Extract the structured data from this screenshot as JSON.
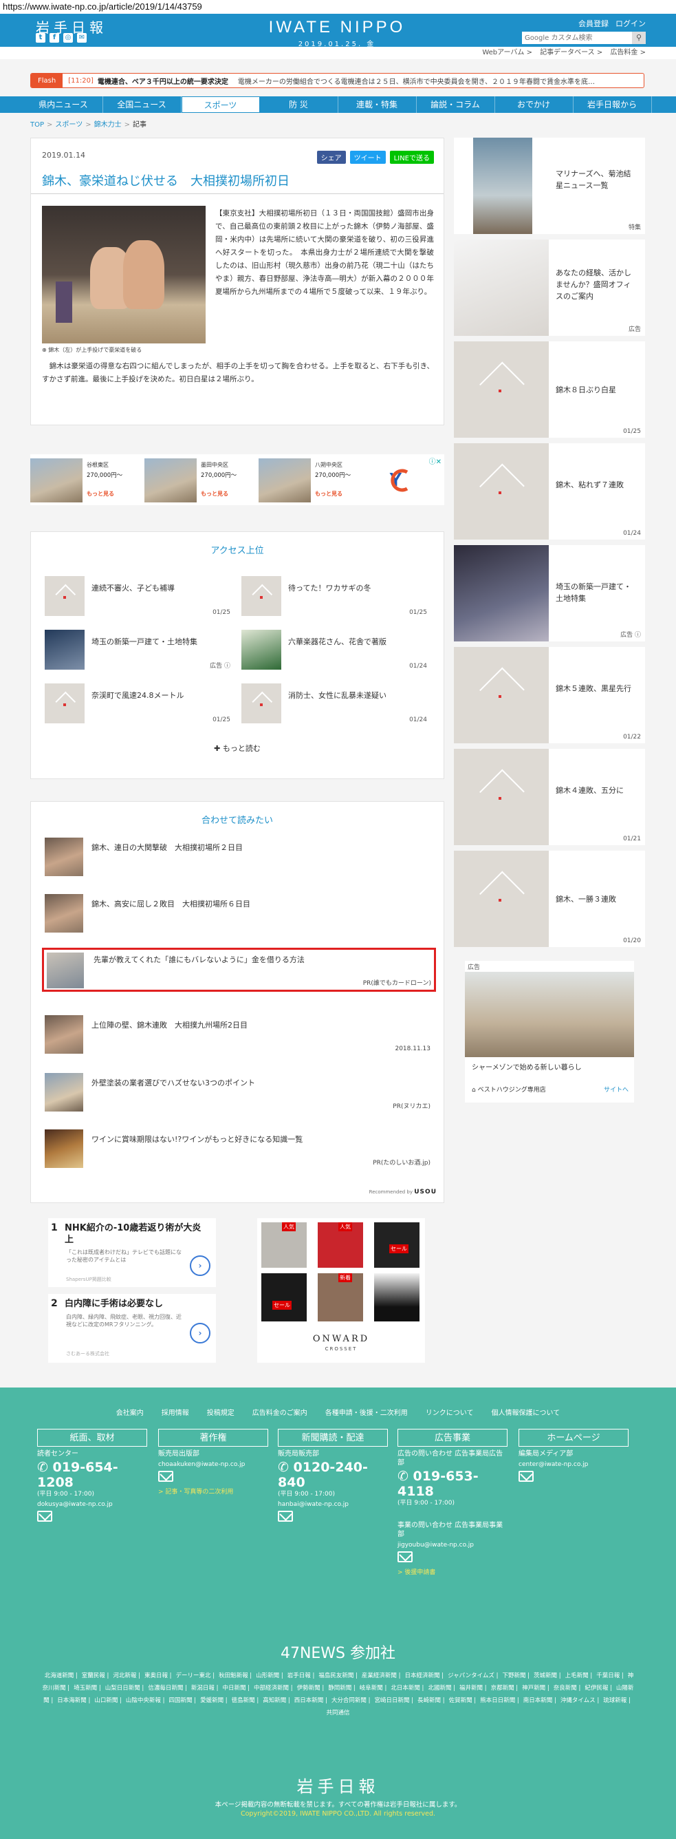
{
  "url": "https://www.iwate-np.co.jp/article/2019/1/14/43759",
  "header": {
    "logo_jp": "岩手日報",
    "brand": "IWATE NIPPO",
    "date": "2019.01.25. 金",
    "member": "会員登録",
    "login": "ログイン",
    "search_placeholder": "Google カスタム検索"
  },
  "subnav": [
    "Webアーバム >",
    "記事データベース >",
    "広告料金 >"
  ],
  "flash": {
    "tag": "Flash",
    "time": "[11:20]",
    "headline": "電機連合、ベア３千円以上の統一要求決定",
    "body": "電機メーカーの労働組合でつくる電機連合は２５日、横浜市で中央委員会を開き、２０１９年春闘で賃金水準を底…"
  },
  "nav": [
    "県内ニュース",
    "全国ニュース",
    "スポーツ",
    "防 災",
    "連載・特集",
    "論説・コラム",
    "おでかけ",
    "岩手日報から"
  ],
  "breadcrumb": [
    "TOP",
    "スポーツ",
    "錦木力士",
    "記事"
  ],
  "article": {
    "date": "2019.01.14",
    "share_fb": "シェア",
    "share_tw": "ツイート",
    "share_line": "LINEで送る",
    "title": "錦木、豪栄道ねじ伏せる　大相撲初場所初日",
    "caption": "錦木（左）が上手投げで豪栄道を破る",
    "body1": "【東京支社】大相撲初場所初日（１３日・両国国技館）盛岡市出身で、自己最高位の東前頭２枚目に上がった錦木（伊勢ノ海部屋、盛岡・米内中）は先場所に続いて大関の豪栄道を破り、初の三役昇進へ好スタートを切った。　本県出身力士が２場所連続で大関を撃破したのは、旧山形村（現久慈市）出身の前乃花（現二十山（はたちやま）親方、春日野部屋、浄法寺高―明大）が新入幕の２０００年夏場所から九州場所までの４場所で５度破って以来、１９年ぶり。",
    "body2": "　錦木は豪栄道の得意な右四つに組んでしまったが、相手の上手を切って胸を合わせる。上手を取ると、右下手も引き、すかさず前進。最後に上手投げを決めた。初日白星は２場所ぶり。"
  },
  "ad_strip": [
    {
      "place": "谷根東区",
      "price": "270,000円～",
      "more": "もっと見る"
    },
    {
      "place": "墨田中央区",
      "price": "270,000円～",
      "more": "もっと見る"
    },
    {
      "place": "八朔中央区",
      "price": "270,000円～",
      "more": "もっと見る"
    }
  ],
  "access": {
    "title": "アクセス上位",
    "more": "もっと読む",
    "items": [
      {
        "title": "連続不審火、子ども補導",
        "date": "01/25"
      },
      {
        "title": "待ってた！ワカサギの冬",
        "date": "01/25"
      },
      {
        "title": "埼玉の新築一戸建て・土地特集",
        "date": "広告 ⓘ"
      },
      {
        "title": "六華楽器花さん、花舎で著版",
        "date": "01/24"
      },
      {
        "title": "奈渓町で風速24.8メートル",
        "date": "01/25"
      },
      {
        "title": "消防士、女性に乱暴未遂疑い",
        "date": "01/24"
      }
    ]
  },
  "related": {
    "title": "合わせて読みたい",
    "items": [
      {
        "title": "錦木、連日の大関撃破　大相撲初場所２日目",
        "src": ""
      },
      {
        "title": "錦木、高安に屈し２敗目　大相撲初場所６日目",
        "src": ""
      },
      {
        "title": "先輩が教えてくれた「誰にもバレないように」金を借りる方法",
        "src": "PR(誰でもカードローン)"
      },
      {
        "title": "上位陣の壁、錦木連敗　大相撲九州場所2日目",
        "src": "2018.11.13"
      },
      {
        "title": "外壁塗装の業者選びでハズせない3つのポイント",
        "src": "PR(ヌリカエ)"
      },
      {
        "title": "ワインに賞味期限はない!?ワインがもっと好きになる知識一覧",
        "src": "PR(たのしいお酒.jp)"
      }
    ],
    "recommended_by": "Recommended by",
    "brand": "USOU"
  },
  "sidebar": [
    {
      "title": "マリナーズへ、菊池結星ニュース一覧",
      "date": "特集"
    },
    {
      "title": "あなたの経験、活かしませんか？盛岡オフィスのご案内",
      "date": "広告"
    },
    {
      "title": "錦木８日ぶり白星",
      "date": "01/25"
    },
    {
      "title": "錦木、粘れず７連敗",
      "date": "01/24"
    },
    {
      "title": "埼玉の新築一戸建て・土地特集",
      "date": "広告 ⓘ"
    },
    {
      "title": "錦木５連敗、黒星先行",
      "date": "01/22"
    },
    {
      "title": "錦木４連敗、五分に",
      "date": "01/21"
    },
    {
      "title": "錦木、一勝３連敗",
      "date": "01/20"
    }
  ],
  "side_ad": {
    "label": "広告",
    "caption": "シャーメゾンで始める新しい暮らし",
    "brand": "ベストハウジング専用店",
    "link": "サイトへ"
  },
  "bottom_ads": [
    {
      "num": "1",
      "title": "NHK紹介の-10歳若返り術が大炎上",
      "desc": "「これは既成者わけだね」テレビでも話題になった秘密のアイテムとは",
      "src": "ShapersUP掲題比較"
    },
    {
      "num": "2",
      "title": "白内障に手術は必要なし",
      "desc": "白内障、緑内障、飛蚊症、老眼、視力回復、近視などに改定のMRフタリンニング。",
      "src": "さむあーる株式会社"
    }
  ],
  "fashion_ad": {
    "brand": "ONWARD",
    "sub": "CROSSET",
    "badges": [
      "人気",
      "人気",
      "セール",
      "セール",
      "新着"
    ]
  },
  "footer": {
    "links": [
      "会社案内",
      "採用情報",
      "投稿規定",
      "広告料金のご案内",
      "各種申請・後援・二次利用",
      "リンクについて",
      "個人情報保護について"
    ],
    "columns": [
      {
        "box": "紙面、取材",
        "label": "読者センター",
        "phone": "019-654-1208",
        "hours": "(平日 9:00 - 17:00)",
        "mail": "dokusya@iwate-np.co.jp",
        "extra": ""
      },
      {
        "box": "著作権",
        "label": "販売局出版部",
        "phone": "",
        "hours": "",
        "mail": "choaakuken@iwate-np.co.jp",
        "extra": "> 記事・写真等の二次利用"
      },
      {
        "box": "新聞購読・配達",
        "label": "販売局販売部",
        "phone": "0120-240-840",
        "hours": "(平日 9:00 - 17:00)",
        "mail": "hanbai@iwate-np.co.jp",
        "extra": ""
      },
      {
        "box": "広告事業",
        "label": "広告の問い合わせ 広告事業局広告部",
        "phone": "019-653-4118",
        "hours": "(平日 9:00 - 17:00)",
        "mail": "jigyoubu@iwate-np.co.jp",
        "extra": "> 後援申請書",
        "label2": "事業の問い合わせ 広告事業局事業部"
      },
      {
        "box": "ホームページ",
        "label": "編集局メディア部",
        "phone": "",
        "hours": "",
        "mail": "center@iwate-np.co.jp",
        "extra": ""
      }
    ],
    "news47": "47NEWS 参加社",
    "papers": [
      "北海道新聞",
      "室蘭民報",
      "河北新報",
      "東奥日報",
      "デーリー東北",
      "秋田魁新報",
      "山形新聞",
      "岩手日報",
      "福島民友新聞",
      "産業経済新聞",
      "日本経済新聞",
      "ジャパンタイムズ",
      "下野新聞",
      "茨城新聞",
      "上毛新聞",
      "千葉日報",
      "神奈川新聞",
      "埼玉新聞",
      "山梨日日新聞",
      "信濃毎日新聞",
      "新潟日報",
      "中日新聞",
      "中部経済新聞",
      "伊勢新聞",
      "静岡新聞",
      "岐阜新聞",
      "北日本新聞",
      "北國新聞",
      "福井新聞",
      "京都新聞",
      "神戸新聞",
      "奈良新聞",
      "紀伊民報",
      "山陽新聞",
      "日本海新聞",
      "山口新聞",
      "山陰中央新報",
      "四国新聞",
      "愛媛新聞",
      "徳島新聞",
      "高知新聞",
      "西日本新聞",
      "大分合同新聞",
      "宮崎日日新聞",
      "長崎新聞",
      "佐賀新聞",
      "熊本日日新聞",
      "南日本新聞",
      "沖縄タイムス",
      "琉球新報",
      "共同通信"
    ],
    "logo": "岩手日報",
    "notice": "本ページ掲載内容の無断転載を禁じます。すべての著作権は岩手日報社に属します。",
    "copyright": "Copyright©2019, IWATE NIPPO CO.,LTD. All rights reserved."
  }
}
